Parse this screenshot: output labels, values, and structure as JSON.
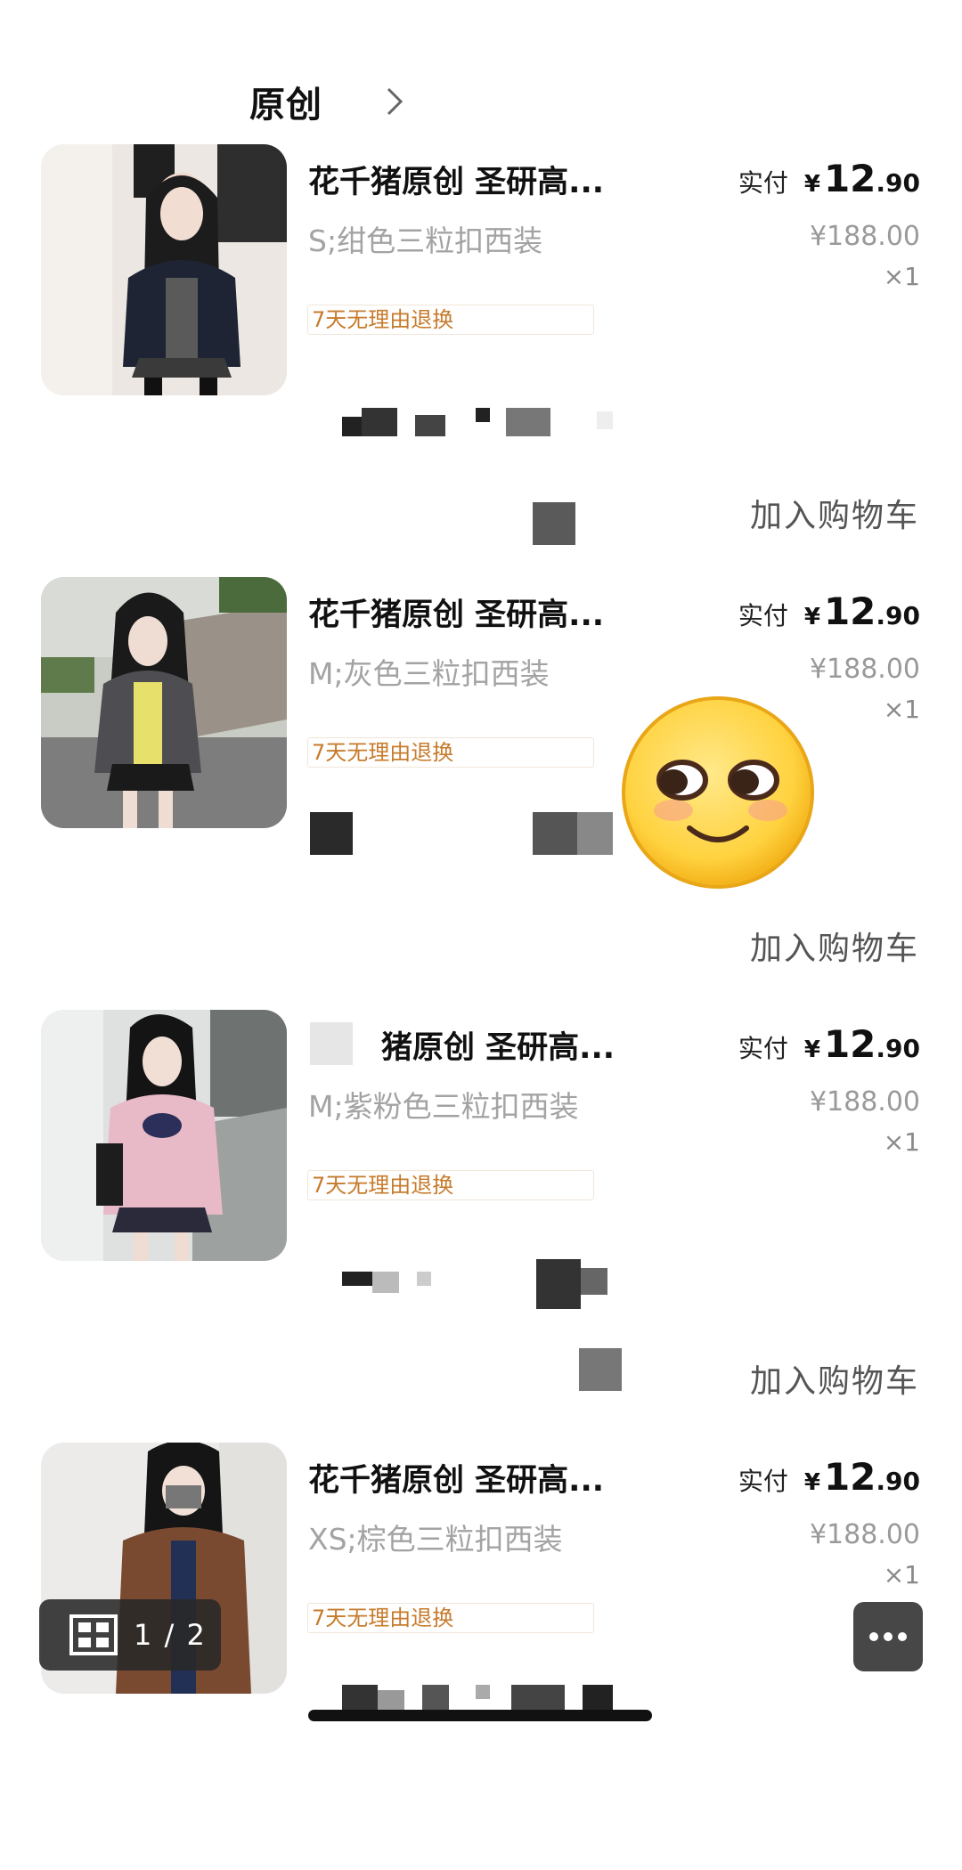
{
  "shop": {
    "name": "原创",
    "chevron_icon": "chevron-right-icon"
  },
  "items": [
    {
      "title": "花千猪原创 圣研高...",
      "sku": "S;绀色三粒扣西装",
      "tag": "7天无理由退换",
      "paid_label": "实付",
      "currency": "¥",
      "price_int": "12",
      "price_dec": ".90",
      "original_price": "¥188.00",
      "quantity": "×1",
      "cart_label": "加入购物车"
    },
    {
      "title": "花千猪原创 圣研高...",
      "sku": "M;灰色三粒扣西装",
      "tag": "7天无理由退换",
      "paid_label": "实付",
      "currency": "¥",
      "price_int": "12",
      "price_dec": ".90",
      "original_price": "¥188.00",
      "quantity": "×1",
      "cart_label": "加入购物车"
    },
    {
      "title": "猪原创 圣研高...",
      "sku": "M;紫粉色三粒扣西装",
      "tag": "7天无理由退换",
      "paid_label": "实付",
      "currency": "¥",
      "price_int": "12",
      "price_dec": ".90",
      "original_price": "¥188.00",
      "quantity": "×1",
      "cart_label": "加入购物车"
    },
    {
      "title": "花千猪原创 圣研高...",
      "sku": "XS;棕色三粒扣西装",
      "tag": "7天无理由退换",
      "paid_label": "实付",
      "currency": "¥",
      "price_int": "12",
      "price_dec": ".90",
      "original_price": "¥188.00",
      "quantity": "×1",
      "cart_label": ""
    }
  ],
  "emoji_sticker": "smirking-face-icon",
  "page_indicator": {
    "icon": "grid-icon",
    "text": "1 / 2"
  },
  "more_button": {
    "icon": "more-dots-icon"
  },
  "colors": {
    "tag_text": "#c77b2c",
    "sku_gray": "#a3a3a3",
    "price": "#111111",
    "overlay_dark": "#2a2a2a"
  }
}
